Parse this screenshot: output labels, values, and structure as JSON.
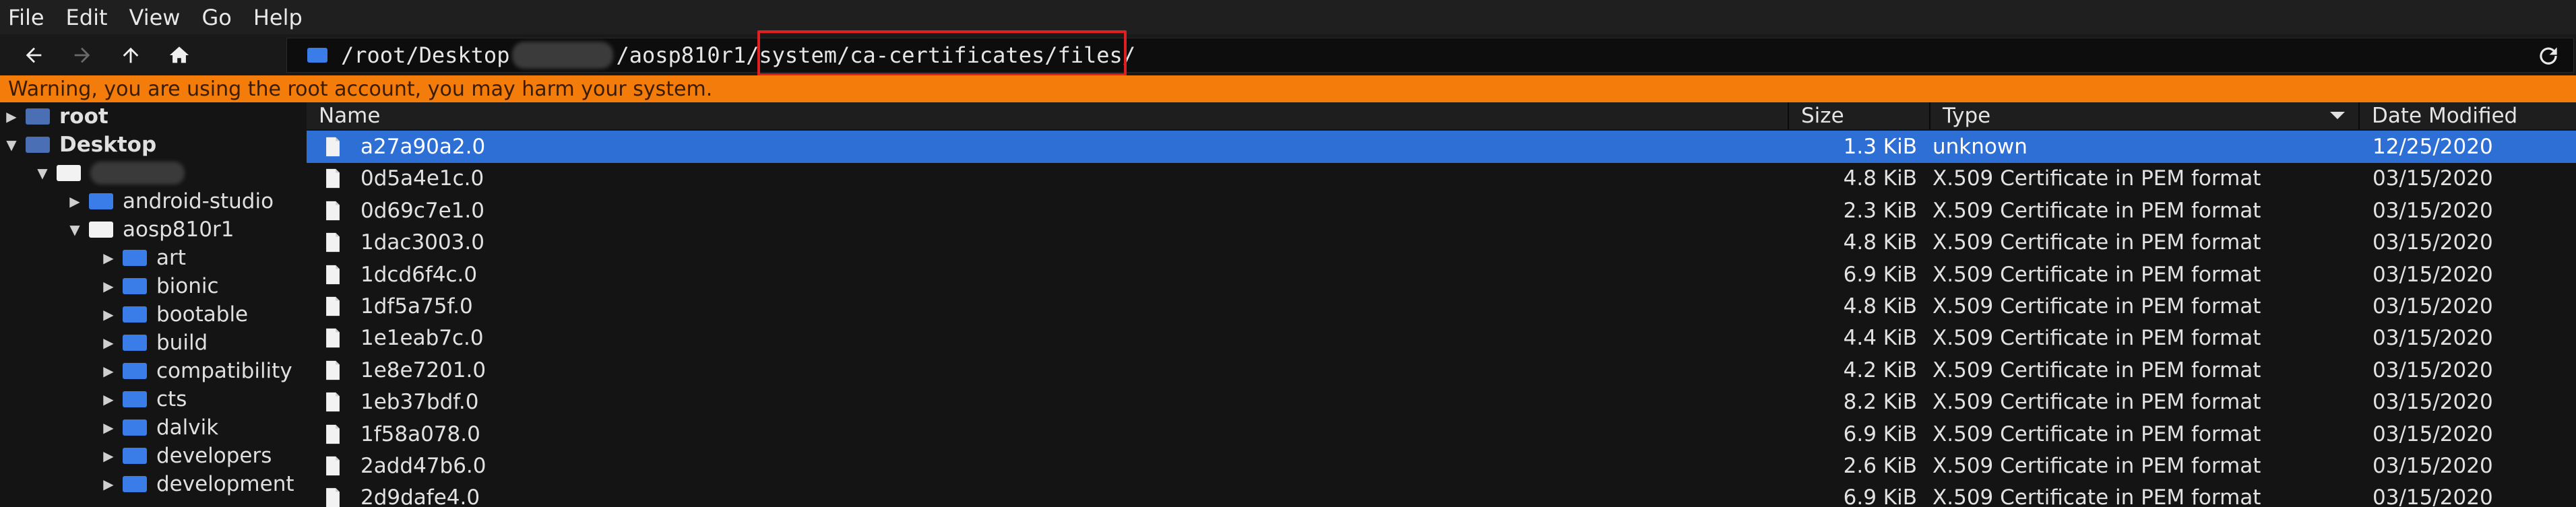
{
  "menu": [
    "File",
    "Edit",
    "View",
    "Go",
    "Help"
  ],
  "toolbar": {
    "back_icon": "arrow-left-icon",
    "forward_icon": "arrow-right-icon",
    "up_icon": "arrow-up-icon",
    "home_icon": "home-icon",
    "reload_icon": "reload-icon"
  },
  "address": {
    "part1": "/root/Desktop",
    "part2": "/aosp810r1",
    "part3": "/system/ca-certificates/files/"
  },
  "warning": "Warning, you are using the root account, you may harm your system.",
  "sidebar": {
    "items": [
      {
        "label": "root"
      },
      {
        "label": "Desktop"
      },
      {
        "label": ""
      },
      {
        "label": "android-studio"
      },
      {
        "label": "aosp810r1"
      },
      {
        "label": "art"
      },
      {
        "label": "bionic"
      },
      {
        "label": "bootable"
      },
      {
        "label": "build"
      },
      {
        "label": "compatibility"
      },
      {
        "label": "cts"
      },
      {
        "label": "dalvik"
      },
      {
        "label": "developers"
      },
      {
        "label": "development"
      }
    ]
  },
  "columns": {
    "name": "Name",
    "size": "Size",
    "type": "Type",
    "date": "Date Modified"
  },
  "files": [
    {
      "name": "a27a90a2.0",
      "size": "1.3 KiB",
      "type": "unknown",
      "date": "12/25/2020"
    },
    {
      "name": "0d5a4e1c.0",
      "size": "4.8 KiB",
      "type": "X.509 Certificate in PEM format",
      "date": "03/15/2020"
    },
    {
      "name": "0d69c7e1.0",
      "size": "2.3 KiB",
      "type": "X.509 Certificate in PEM format",
      "date": "03/15/2020"
    },
    {
      "name": "1dac3003.0",
      "size": "4.8 KiB",
      "type": "X.509 Certificate in PEM format",
      "date": "03/15/2020"
    },
    {
      "name": "1dcd6f4c.0",
      "size": "6.9 KiB",
      "type": "X.509 Certificate in PEM format",
      "date": "03/15/2020"
    },
    {
      "name": "1df5a75f.0",
      "size": "4.8 KiB",
      "type": "X.509 Certificate in PEM format",
      "date": "03/15/2020"
    },
    {
      "name": "1e1eab7c.0",
      "size": "4.4 KiB",
      "type": "X.509 Certificate in PEM format",
      "date": "03/15/2020"
    },
    {
      "name": "1e8e7201.0",
      "size": "4.2 KiB",
      "type": "X.509 Certificate in PEM format",
      "date": "03/15/2020"
    },
    {
      "name": "1eb37bdf.0",
      "size": "8.2 KiB",
      "type": "X.509 Certificate in PEM format",
      "date": "03/15/2020"
    },
    {
      "name": "1f58a078.0",
      "size": "6.9 KiB",
      "type": "X.509 Certificate in PEM format",
      "date": "03/15/2020"
    },
    {
      "name": "2add47b6.0",
      "size": "2.6 KiB",
      "type": "X.509 Certificate in PEM format",
      "date": "03/15/2020"
    },
    {
      "name": "2d9dafe4.0",
      "size": "6.9 KiB",
      "type": "X.509 Certificate in PEM format",
      "date": "03/15/2020"
    }
  ]
}
